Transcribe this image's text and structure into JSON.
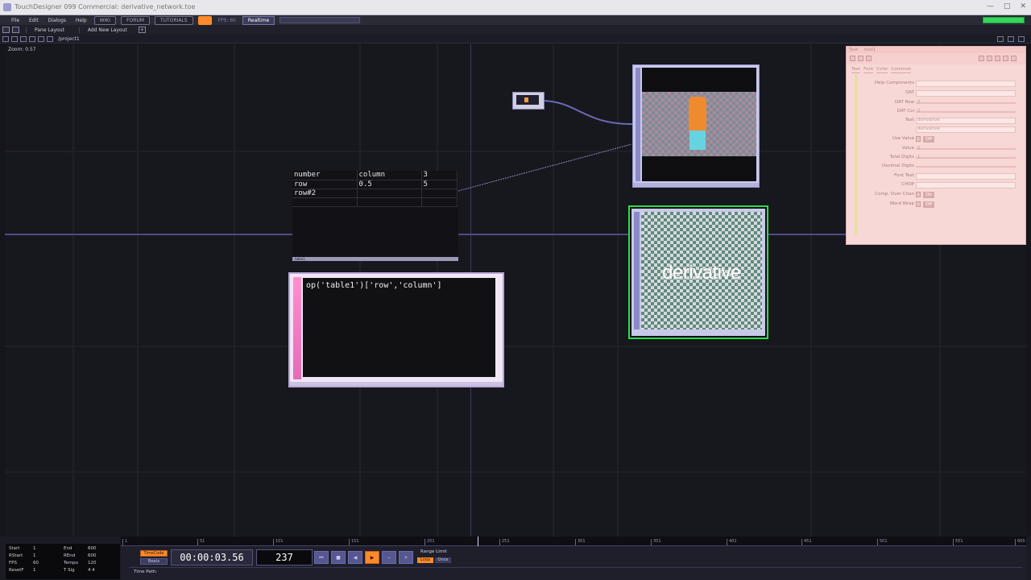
{
  "window": {
    "title": "TouchDesigner 099 Commercial: derivative_network.toe"
  },
  "menu": {
    "items": [
      "File",
      "Edit",
      "Dialogs",
      "Help"
    ],
    "pills": [
      "WIKI",
      "FORUM",
      "TUTORIALS"
    ],
    "fps_label": "FPS: 60",
    "realtime_label": "Realtime"
  },
  "pane_bar": {
    "pane_layout": "Pane Layout",
    "add_layout": "Add New Layout"
  },
  "network_bar": {
    "path": "/project1"
  },
  "network": {
    "zoom": "Zoom: 0.57",
    "table": {
      "rows": [
        [
          "number",
          "column",
          "3"
        ],
        [
          "row",
          "0.5",
          "5"
        ],
        [
          "row#2",
          "",
          ""
        ],
        [
          "",
          "",
          ""
        ]
      ],
      "label": "table1"
    },
    "text_dat": {
      "code": "op('table1')['row','column']"
    },
    "derivative_top": {
      "text": "derivative"
    }
  },
  "params": {
    "header_type": "Text",
    "header_name": "text1",
    "tabs": [
      "Text",
      "Font",
      "Color",
      "Common"
    ],
    "rows": [
      {
        "label": "Help Components",
        "kind": "field"
      },
      {
        "label": "DAT",
        "kind": "field"
      },
      {
        "label": "DAT Row",
        "kind": "slider",
        "value": "0"
      },
      {
        "label": "DAT Col",
        "kind": "slider",
        "value": "0"
      },
      {
        "label": "Text",
        "kind": "field",
        "value": "derivative"
      },
      {
        "label": "",
        "kind": "field",
        "value": "derivative"
      },
      {
        "label": "Use Value",
        "kind": "toggle",
        "value": "Off"
      },
      {
        "label": "Value",
        "kind": "slider",
        "value": "0"
      },
      {
        "label": "Total Digits",
        "kind": "slider",
        "value": "1"
      },
      {
        "label": "Decimal Digits",
        "kind": "slider",
        "value": ""
      },
      {
        "label": "Font Text",
        "kind": "field"
      },
      {
        "label": "CHOP",
        "kind": "field"
      },
      {
        "label": "Comp. Over Chan",
        "kind": "toggle",
        "value": "On"
      },
      {
        "label": "Word Wrap",
        "kind": "toggle",
        "value": "Off"
      }
    ]
  },
  "timeline": {
    "info": [
      [
        "Start",
        "1",
        "End",
        "600"
      ],
      [
        "RStart",
        "1",
        "REnd",
        "600"
      ],
      [
        "FPS",
        "60",
        "Tempo",
        "120"
      ],
      [
        "ResetF",
        "1",
        "T Sig",
        "4   4"
      ]
    ],
    "ticks": [
      "1",
      "51",
      "101",
      "151",
      "201",
      "251",
      "301",
      "351",
      "401",
      "451",
      "501",
      "551",
      "600"
    ],
    "time_code": "00:00:03.56",
    "frame": "237",
    "timecode_btn": "TimeCode",
    "beats_btn": "Beats",
    "range_limit": "Range Limit",
    "loop": "Loop",
    "once": "Once",
    "time_path": "Time Path:"
  }
}
